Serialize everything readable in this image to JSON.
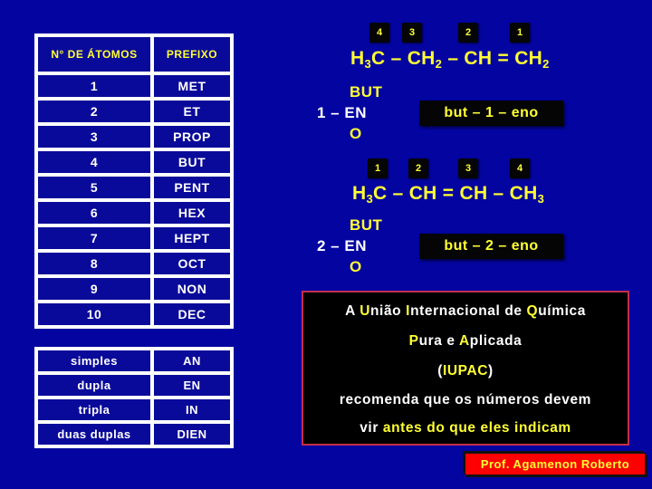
{
  "table_atoms": {
    "headers": [
      "N° DE ÁTOMOS",
      "PREFIXO"
    ],
    "rows": [
      [
        "1",
        "MET"
      ],
      [
        "2",
        "ET"
      ],
      [
        "3",
        "PROP"
      ],
      [
        "4",
        "BUT"
      ],
      [
        "5",
        "PENT"
      ],
      [
        "6",
        "HEX"
      ],
      [
        "7",
        "HEPT"
      ],
      [
        "8",
        "OCT"
      ],
      [
        "9",
        "NON"
      ],
      [
        "10",
        "DEC"
      ]
    ]
  },
  "table_bonds": {
    "rows": [
      [
        "simples",
        "AN"
      ],
      [
        "dupla",
        "EN"
      ],
      [
        "tripla",
        "IN"
      ],
      [
        "duas duplas",
        "DIEN"
      ]
    ]
  },
  "example1": {
    "badges": [
      "4",
      "3",
      "2",
      "1"
    ],
    "formula": {
      "p1": "H",
      "s1": "3",
      "p2": "C – CH",
      "s2": "2",
      "p3": " – CH = CH",
      "s3": "2"
    },
    "breakdown": {
      "top": "BUT",
      "prefix": "1 – ",
      "mid": "EN",
      "bottom": "O"
    },
    "name": "but – 1 – eno"
  },
  "example2": {
    "badges": [
      "1",
      "2",
      "3",
      "4"
    ],
    "formula": {
      "p1": "H",
      "s1": "3",
      "p2": "C – CH = CH – CH",
      "s2": "3"
    },
    "breakdown": {
      "top": "BUT",
      "prefix": "2 – ",
      "mid": "EN",
      "bottom": "O"
    },
    "name": "but – 2 – eno"
  },
  "iupac_box": {
    "line1": {
      "a": "A ",
      "b": "U",
      "c": "nião ",
      "d": "I",
      "e": "nternacional de ",
      "f": "Q",
      "g": "uímica"
    },
    "line2": {
      "a": "P",
      "b": "ura e ",
      "c": "A",
      "d": "plicada"
    },
    "line3": {
      "a": "(",
      "b": "IUPAC",
      "c": ")"
    },
    "line4": "recomenda que os números devem",
    "line5": {
      "a": "vir ",
      "b": "antes do que eles indicam"
    }
  },
  "credit": "Prof. Agamenon Roberto",
  "colors": {
    "background": "#0404a0",
    "accent_yellow": "#ffff33",
    "credit_red": "#ff0000"
  }
}
